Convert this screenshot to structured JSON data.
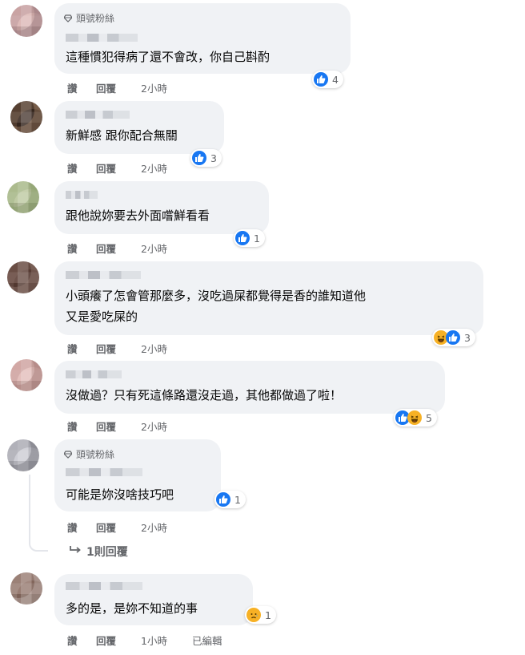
{
  "comments": [
    {
      "badge": "頭號粉絲",
      "text": "這種慣犯得病了還不會改，你自己斟酌",
      "actions": {
        "like": "讚",
        "reply": "回覆",
        "time": "2小時"
      },
      "reactions": {
        "icons": [
          "like"
        ],
        "count": "4"
      },
      "avatar_colors": [
        "#d9b2b0",
        "#8a6a73"
      ]
    },
    {
      "badge": "",
      "text": "新鮮感 跟你配合無關",
      "actions": {
        "like": "讚",
        "reply": "回覆",
        "time": "2小時"
      },
      "reactions": {
        "icons": [
          "like"
        ],
        "count": "3"
      },
      "avatar_colors": [
        "#3b2a21",
        "#c49b7a"
      ]
    },
    {
      "badge": "",
      "text": "跟他說妳要去外面嚐鮮看看",
      "actions": {
        "like": "讚",
        "reply": "回覆",
        "time": "2小時"
      },
      "reactions": {
        "icons": [
          "like"
        ],
        "count": "1"
      },
      "avatar_colors": [
        "#b8c49a",
        "#7f9a5e"
      ]
    },
    {
      "badge": "",
      "text": "小頭癢了怎會管那麼多，沒吃過屎都覺得是香的誰知道他\n又是愛吃屎的",
      "actions": {
        "like": "讚",
        "reply": "回覆",
        "time": "2小時"
      },
      "reactions": {
        "icons": [
          "haha",
          "like"
        ],
        "count": "3"
      },
      "avatar_colors": [
        "#5d4037",
        "#a1887f"
      ]
    },
    {
      "badge": "",
      "text": "沒做過？只有死這條路還沒走過，其他都做過了啦！",
      "actions": {
        "like": "讚",
        "reply": "回覆",
        "time": "2小時"
      },
      "reactions": {
        "icons": [
          "like",
          "haha"
        ],
        "count": "5"
      },
      "avatar_colors": [
        "#e0b8b4",
        "#9c6b68"
      ]
    },
    {
      "badge": "頭號粉絲",
      "text": "可能是妳沒啥技巧吧",
      "actions": {
        "like": "讚",
        "reply": "回覆",
        "time": "2小時"
      },
      "reactions": {
        "icons": [
          "like"
        ],
        "count": "1"
      },
      "avatar_colors": [
        "#c7c7cf",
        "#5c5c66"
      ]
    },
    {
      "badge": "",
      "text": "多的是，是妳不知道的事",
      "actions": {
        "like": "讚",
        "reply": "回覆",
        "time": "1小時",
        "edited": "已編輯"
      },
      "reactions": {
        "icons": [
          "sad"
        ],
        "count": "1"
      },
      "avatar_colors": [
        "#8d6e63",
        "#d7ccc8"
      ]
    }
  ],
  "replies_link": {
    "label": "1則回覆"
  },
  "colors": {
    "bubble": "#f0f2f5",
    "meta": "#65676b",
    "like_blue": "#1877f2",
    "haha_yellow": "#f7b125"
  }
}
